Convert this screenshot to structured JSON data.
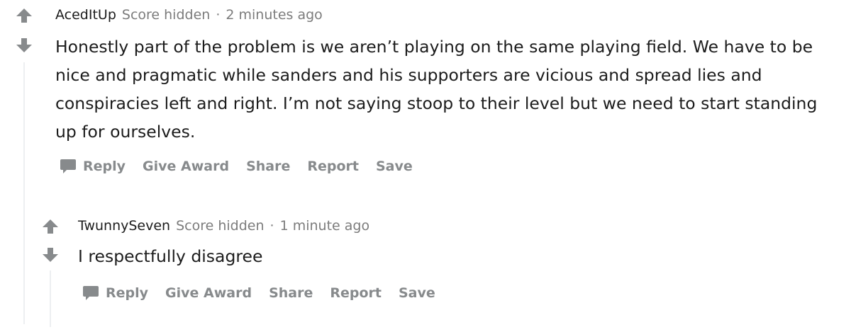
{
  "comments": [
    {
      "author": "AcedItUp",
      "score": "Score hidden",
      "separator": "·",
      "time": "2 minutes ago",
      "body": "Honestly part of the problem is we aren’t playing on the same playing field. We have to be nice and pragmatic while sanders and his supporters are vicious and spread lies and conspiracies left and right. I’m not saying stoop to their level but we need to start standing up for ourselves.",
      "actions": {
        "reply": "Reply",
        "give_award": "Give Award",
        "share": "Share",
        "report": "Report",
        "save": "Save"
      }
    },
    {
      "author": "TwunnySeven",
      "score": "Score hidden",
      "separator": "·",
      "time": "1 minute ago",
      "body": "I respectfully disagree",
      "actions": {
        "reply": "Reply",
        "give_award": "Give Award",
        "share": "Share",
        "report": "Report",
        "save": "Save"
      }
    }
  ],
  "icons": {
    "upvote": "arrow-up-icon",
    "downvote": "arrow-down-icon",
    "reply": "speech-bubble-icon"
  },
  "colors": {
    "arrow": "#878a8c",
    "muted_text": "#7c7c7c",
    "action_text": "#878a8c",
    "thread_line": "#edeff1"
  }
}
